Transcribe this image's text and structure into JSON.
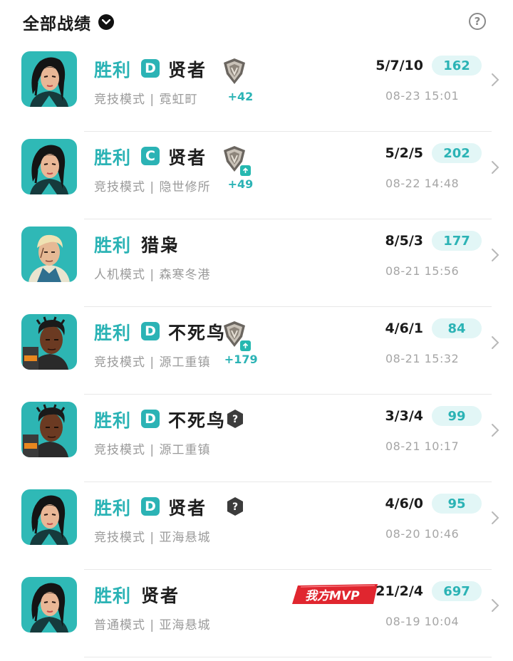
{
  "header": {
    "filter_label": "全部战绩",
    "filter_icon": "chevron-down-icon",
    "help_icon": "help-icon",
    "help_glyph": "?"
  },
  "colors": {
    "accent": "#2bb3b5",
    "score_bg": "#e2f6f6",
    "mvp_red": "#e0262f"
  },
  "matches": [
    {
      "result": "胜利",
      "rank": "D",
      "hero": "贤者",
      "avatar": "sage",
      "mode": "竞技模式 | 霓虹町",
      "rank_icon": "silver-rank-icon",
      "rank_up": false,
      "delta": "+42",
      "kda": "5/7/10",
      "score": "162",
      "date": "08-23 15:01"
    },
    {
      "result": "胜利",
      "rank": "C",
      "hero": "贤者",
      "avatar": "sage",
      "mode": "竞技模式 | 隐世修所",
      "rank_icon": "silver-rank-icon",
      "rank_up": true,
      "delta": "+49",
      "kda": "5/2/5",
      "score": "202",
      "date": "08-22 14:48"
    },
    {
      "result": "胜利",
      "rank": "",
      "hero": "猎枭",
      "avatar": "sova",
      "mode": "人机模式 | 森寒冬港",
      "rank_icon": "",
      "rank_up": false,
      "delta": "",
      "kda": "8/5/3",
      "score": "177",
      "date": "08-21 15:56"
    },
    {
      "result": "胜利",
      "rank": "D",
      "hero": "不死鸟",
      "avatar": "phoenix",
      "mode": "竞技模式 | 源工重镇",
      "rank_icon": "silver-rank-icon",
      "rank_up": true,
      "delta": "+179",
      "kda": "4/6/1",
      "score": "84",
      "date": "08-21 15:32"
    },
    {
      "result": "胜利",
      "rank": "D",
      "hero": "不死鸟",
      "avatar": "phoenix",
      "mode": "竞技模式 | 源工重镇",
      "rank_icon": "unknown-rank-icon",
      "rank_up": false,
      "delta": "",
      "kda": "3/3/4",
      "score": "99",
      "date": "08-21 10:17"
    },
    {
      "result": "胜利",
      "rank": "D",
      "hero": "贤者",
      "avatar": "sage",
      "mode": "竞技模式 | 亚海悬城",
      "rank_icon": "unknown-rank-icon",
      "rank_up": false,
      "delta": "",
      "kda": "4/6/0",
      "score": "95",
      "date": "08-20 10:46"
    },
    {
      "result": "胜利",
      "rank": "",
      "hero": "贤者",
      "avatar": "sage",
      "mode": "普通模式 | 亚海悬城",
      "rank_icon": "",
      "rank_up": false,
      "delta": "",
      "kda": "21/2/4",
      "score": "697",
      "date": "08-19 10:04",
      "mvp": "我方MVP"
    }
  ]
}
